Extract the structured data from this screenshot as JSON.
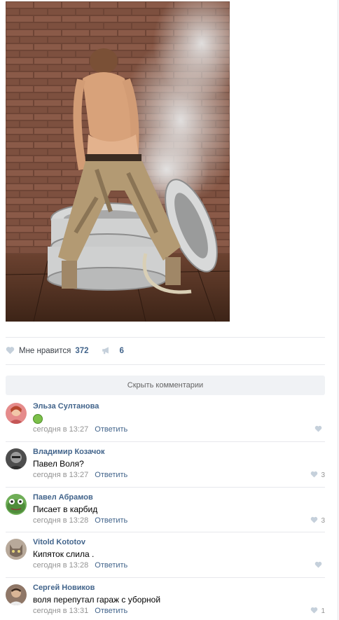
{
  "post": {
    "photo_alt": "",
    "likes_label": "Мне нравится",
    "likes_count": "372",
    "shares_count": "6"
  },
  "comments_panel": {
    "hide_label": "Скрыть комментарии"
  },
  "comments": [
    {
      "author": "Эльза Султанова",
      "text": "",
      "has_emoji": true,
      "time": "сегодня в 13:27",
      "reply": "Ответить",
      "likes": ""
    },
    {
      "author": "Владимир Козачок",
      "text": "Павел Воля?",
      "time": "сегодня в 13:27",
      "reply": "Ответить",
      "likes": "3"
    },
    {
      "author": "Павел Абрамов",
      "text": "Писает в карбид",
      "time": "сегодня в 13:28",
      "reply": "Ответить",
      "likes": "3"
    },
    {
      "author": "Vitold Kototov",
      "text": "Кипяток слила .",
      "time": "сегодня в 13:28",
      "reply": "Ответить",
      "likes": ""
    },
    {
      "author": "Сергей Новиков",
      "text": "воля перепутал гараж с уборной",
      "time": "сегодня в 13:31",
      "reply": "Ответить",
      "likes": "1"
    }
  ],
  "colors": {
    "link": "#42648b",
    "muted": "#939393",
    "divider": "#e7e8ec",
    "panel_bg": "#f0f2f5"
  },
  "icons": {
    "like": "heart-icon",
    "share": "megaphone-icon",
    "emoji": "nauseated-face-emoji-icon"
  }
}
